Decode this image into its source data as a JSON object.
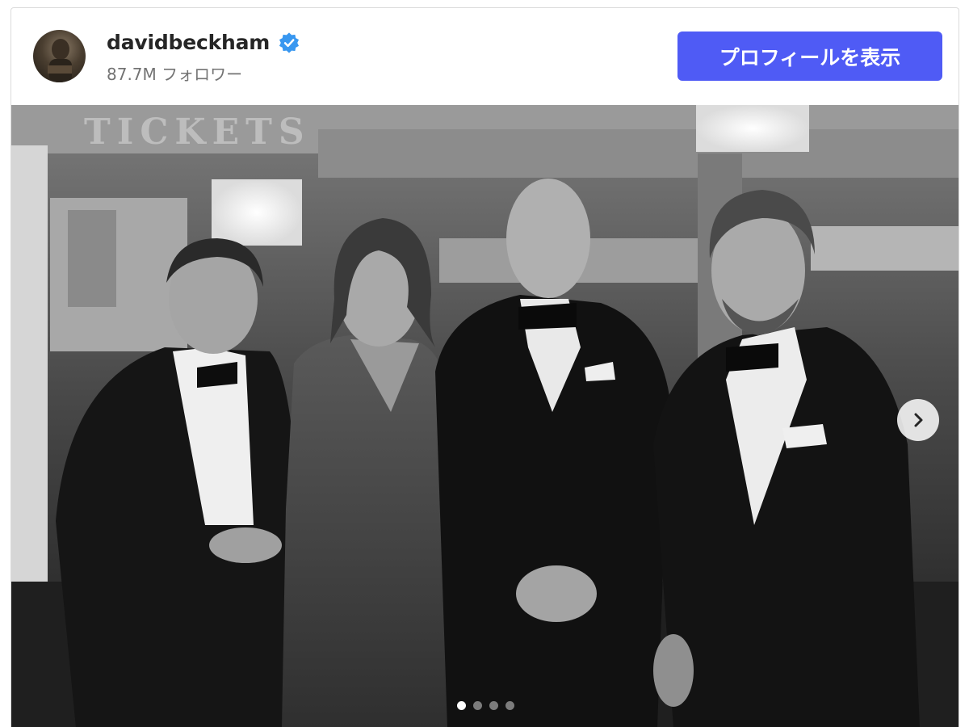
{
  "post": {
    "username": "davidbeckham",
    "verified": true,
    "followers_text": "87.7M フォロワー",
    "view_profile_label": "プロフィールを表示"
  },
  "photo": {
    "sign_text": "TICKETS",
    "carousel": {
      "slide_count": 4,
      "active_index": 0
    }
  },
  "colors": {
    "accent": "#4f5bf5",
    "verified": "#3897f0",
    "text_primary": "#262626",
    "text_secondary": "#737373"
  },
  "icons": {
    "verified": "verified-badge-icon",
    "next": "chevron-right-icon"
  }
}
